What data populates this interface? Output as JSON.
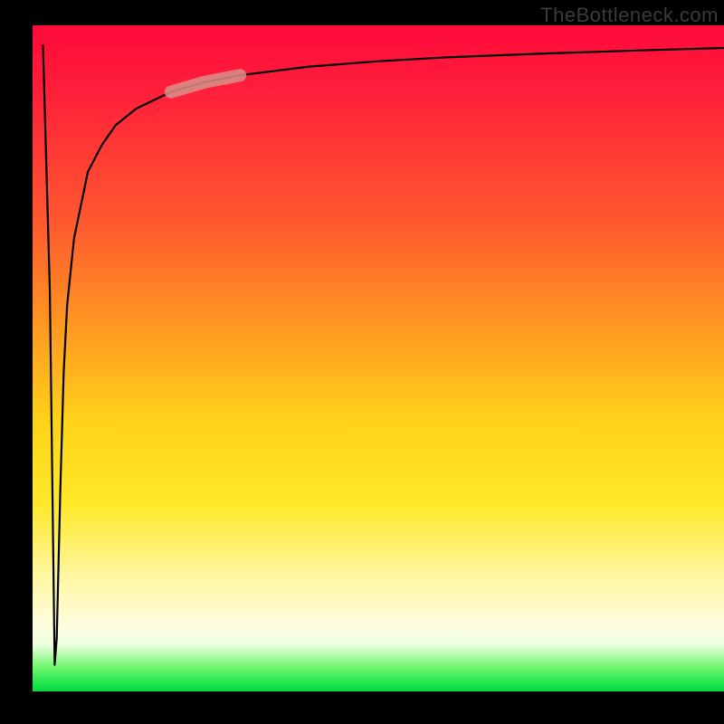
{
  "watermark": "TheBottleneck.com",
  "chart_data": {
    "type": "line",
    "title": "",
    "xlabel": "",
    "ylabel": "",
    "xlim": [
      0,
      100
    ],
    "ylim": [
      0,
      100
    ],
    "background_gradient": {
      "top_color": "#ff0a3a",
      "bottom_color": "#0bd943",
      "description": "vertical red→orange→yellow→pale→green gradient, green only at very bottom"
    },
    "series": [
      {
        "name": "bottleneck-curve",
        "description": "Sharp spike down near x≈3 then steep rise approaching top asymptote",
        "x": [
          1.5,
          2.5,
          3.0,
          3.2,
          3.5,
          4.0,
          4.5,
          5.0,
          6.0,
          8.0,
          10,
          12,
          15,
          20,
          25,
          30,
          40,
          50,
          60,
          75,
          90,
          100
        ],
        "y": [
          97,
          60,
          20,
          4,
          8,
          30,
          48,
          58,
          68,
          78,
          82,
          85,
          87.5,
          90,
          91.5,
          92.5,
          93.8,
          94.6,
          95.2,
          95.8,
          96.3,
          96.6
        ]
      }
    ],
    "highlight": {
      "description": "pale pink rounded segment overlaid on curve",
      "x_range": [
        20,
        30
      ],
      "y_range": [
        88,
        92
      ],
      "color": "#d98f8a"
    }
  }
}
